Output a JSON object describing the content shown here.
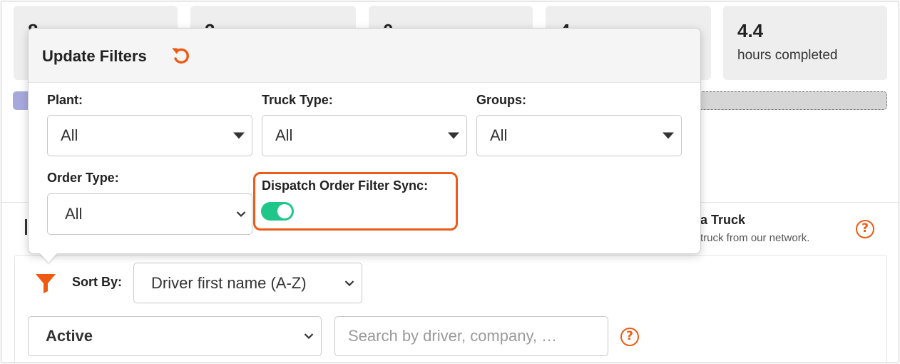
{
  "stats": [
    {
      "value": "8",
      "label": ""
    },
    {
      "value": "2",
      "label": ""
    },
    {
      "value": "0",
      "label": ""
    },
    {
      "value": "4",
      "label": ""
    },
    {
      "value": "4.4",
      "label": "hours completed"
    }
  ],
  "colors": {
    "accent": "#ef5a12",
    "toggle_on": "#1fc68a",
    "highlight_border": "#ec5b1a"
  },
  "truck_card": {
    "title": "a Truck",
    "subtitle": "truck from our network."
  },
  "help_icon_glyph": "?",
  "filters_popover": {
    "title": "Update Filters",
    "reset_icon": "reset-icon",
    "plant": {
      "label": "Plant:",
      "value": "All"
    },
    "truck_type": {
      "label": "Truck Type:",
      "value": "All"
    },
    "groups": {
      "label": "Groups:",
      "value": "All"
    },
    "order_type": {
      "label": "Order Type:",
      "value": "All"
    },
    "dispatch_sync": {
      "label": "Dispatch Order Filter Sync:",
      "enabled": true
    }
  },
  "toolbar": {
    "filter_icon": "filter-icon",
    "sort_by_label": "Sort By:",
    "sort_value": "Driver first name (A-Z)",
    "status_value": "Active",
    "search_placeholder": "Search by driver, company, …"
  }
}
